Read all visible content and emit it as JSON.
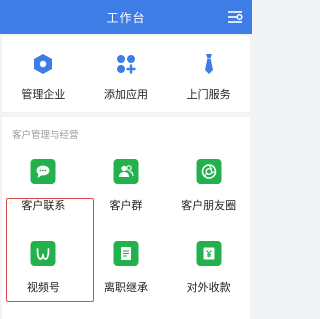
{
  "header": {
    "title": "工作台",
    "settings_icon": "settings-sliders-icon"
  },
  "top_apps": [
    {
      "label": "管理企业",
      "icon": "hexagon-icon"
    },
    {
      "label": "添加应用",
      "icon": "add-apps-icon"
    },
    {
      "label": "上门服务",
      "icon": "necktie-icon"
    }
  ],
  "section": {
    "title": "客户管理与经营",
    "apps": [
      {
        "label": "客户联系",
        "icon": "chat-bubble-icon"
      },
      {
        "label": "客户群",
        "icon": "group-icon"
      },
      {
        "label": "客户朋友圈",
        "icon": "camera-shutter-icon"
      },
      {
        "label": "视频号",
        "icon": "channels-icon"
      },
      {
        "label": "离职继承",
        "icon": "document-icon"
      },
      {
        "label": "对外收款",
        "icon": "yuan-payment-icon"
      }
    ]
  },
  "colors": {
    "header_bg": "#3e7de6",
    "top_icon_blue": "#3e7de6",
    "tile_green": "#22b14c",
    "highlight_red": "#d94a48"
  }
}
